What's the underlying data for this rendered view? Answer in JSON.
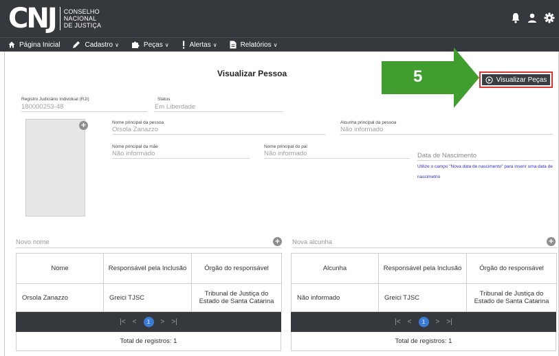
{
  "header": {
    "logo_mark": "CNJ",
    "logo_lines": [
      "CONSELHO",
      "NACIONAL",
      "DE JUSTIÇA"
    ],
    "icons": [
      "bell-icon",
      "user-icon",
      "gear-icon"
    ]
  },
  "nav": {
    "items": [
      {
        "label": "Página Inicial",
        "icon": "home-icon",
        "caret": ""
      },
      {
        "label": "Cadastro",
        "icon": "pencil-icon",
        "caret": "∨"
      },
      {
        "label": "Peças",
        "icon": "puzzle-icon",
        "caret": "∨"
      },
      {
        "label": "Alertas",
        "icon": "exclamation-icon",
        "caret": "∨"
      },
      {
        "label": "Relatórios",
        "icon": "document-icon",
        "caret": "∨"
      }
    ]
  },
  "page": {
    "title": "Visualizar Pessoa",
    "annotation_number": "5",
    "view_pieces_button": "Visualizar Peças"
  },
  "form": {
    "rji_label": "Registro Judiciário Individual (RJI)",
    "rji_value": "180000253-48",
    "status_label": "Status",
    "status_value": "Em Liberdade",
    "main_name_label": "Nome principal da pessoa",
    "main_name_value": "Orsola Zanazzo",
    "main_alias_label": "Alcunha principal da pessoa",
    "main_alias_value": "Não informado",
    "mother_label": "Nome principal da mãe",
    "mother_value": "Não informado",
    "father_label": "Nome principal do pai",
    "father_value": "Não informado",
    "birth_placeholder": "Data de Nascimento",
    "birth_hint": "Utilize o campo \"Nova data de nascimento\" para inserir uma data de nascimetno",
    "new_name_placeholder": "Novo nome",
    "new_alias_placeholder": "Nova alcunha"
  },
  "names_table": {
    "headers": [
      "Nome",
      "Responsável pela Inclusão",
      "Órgão do responsável"
    ],
    "rows": [
      [
        "Orsola Zanazzo",
        "Greici TJSC",
        "Tribunal de Justiça do Estado de Santa Catarina"
      ]
    ],
    "pager": {
      "first": "|<",
      "prev": "<",
      "current": "1",
      "next": ">",
      "last": ">|"
    },
    "total": "Total de registros: 1"
  },
  "alias_table": {
    "headers": [
      "Alcunha",
      "Responsável pela Inclusão",
      "Órgão do responsável"
    ],
    "rows": [
      [
        "Não informado",
        "Greici TJSC",
        "Tribunal de Justiça do Estado de Santa Catarina"
      ]
    ],
    "pager": {
      "first": "|<",
      "prev": "<",
      "current": "1",
      "next": ">",
      "last": ">|"
    },
    "total": "Total de registros: 1"
  },
  "colors": {
    "topbar": "#35383d",
    "annotation_green": "#3f9e2e",
    "highlight_red": "#dd3333",
    "page_current": "#3a7bd5"
  }
}
